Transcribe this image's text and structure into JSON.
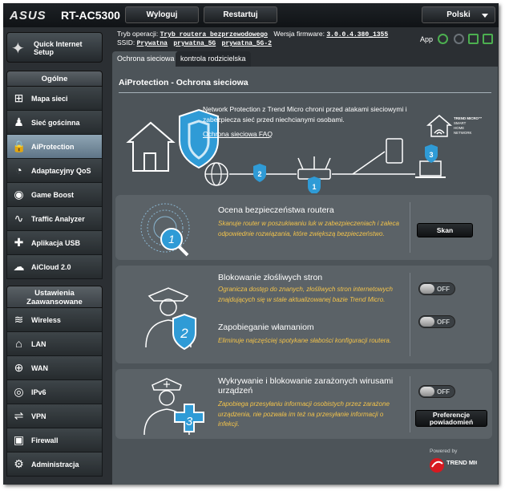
{
  "header": {
    "brand": "ASUS",
    "model": "RT-AC5300",
    "logout": "Wyloguj",
    "restart": "Restartuj",
    "language": "Polski"
  },
  "status": {
    "mode_label": "Tryb operacji:",
    "mode_value": "Tryb routera bezprzewodowego",
    "firmware_label": "Wersja firmware:",
    "firmware_value": "3.0.0.4.380_1355",
    "ssid_label": "SSID:",
    "ssids": [
      "Prywatna",
      "prywatna_5G",
      "prywatna_5G-2"
    ],
    "app_label": "App"
  },
  "sidebar": {
    "qis_label": "Quick Internet Setup",
    "general_header": "Ogólne",
    "general_items": [
      {
        "label": "Mapa sieci",
        "icon": "network-map-icon"
      },
      {
        "label": "Sieć gościnna",
        "icon": "guest-network-icon"
      },
      {
        "label": "AiProtection",
        "icon": "lock-icon"
      },
      {
        "label": "Adaptacyjny QoS",
        "icon": "qos-gauge-icon"
      },
      {
        "label": "Game Boost",
        "icon": "gamepad-icon"
      },
      {
        "label": "Traffic Analyzer",
        "icon": "chart-icon"
      },
      {
        "label": "Aplikacja USB",
        "icon": "puzzle-icon"
      },
      {
        "label": "AiCloud 2.0",
        "icon": "cloud-icon"
      }
    ],
    "advanced_header": "Ustawienia Zaawansowane",
    "advanced_items": [
      {
        "label": "Wireless",
        "icon": "wifi-icon"
      },
      {
        "label": "LAN",
        "icon": "home-icon"
      },
      {
        "label": "WAN",
        "icon": "globe-icon"
      },
      {
        "label": "IPv6",
        "icon": "ipv6-icon"
      },
      {
        "label": "VPN",
        "icon": "vpn-icon"
      },
      {
        "label": "Firewall",
        "icon": "firewall-icon"
      },
      {
        "label": "Administracja",
        "icon": "admin-icon"
      }
    ]
  },
  "tabs": [
    "Ochrona sieciowa",
    "kontrola rodzicielska"
  ],
  "main": {
    "title": "AiProtection - Ochrona sieciowa",
    "intro": "Network Protection z Trend Micro chroni przed atakami sieciowymi i zabezpiecza sieć przed niechcianymi osobami.",
    "faq": "Ochrona sieciowa FAQ",
    "trend_logo_text": "TREND MICRO™ SMART HOME NETWORK",
    "diagram_numbers": [
      "1",
      "2",
      "3"
    ],
    "card1": {
      "number": "1",
      "title": "Ocena bezpieczeństwa routera",
      "desc": "Skanuje router w poszukiwaniu luk w zabezpieczeniach i zaleca odpowiednie rozwiązania, które zwiększą bezpieczeństwo.",
      "button": "Skan"
    },
    "card2": {
      "number": "2",
      "title_a": "Blokowanie złośliwych stron",
      "desc_a": "Ogranicza dostęp do znanych, złośliwych stron internetowych znajdujących się w stale aktualizowanej bazie Trend Micro.",
      "toggle_a": "OFF",
      "title_b": "Zapobieganie włamaniom",
      "desc_b": "Eliminuje najczęściej spotykane słabości konfiguracji routera.",
      "toggle_b": "OFF"
    },
    "card3": {
      "number": "3",
      "title": "Wykrywanie i blokowanie zarażonych wirusami urządzeń",
      "desc": "Zapobiega przesyłaniu informacji osobistych przez zarażone urządzenia, nie pozwala im też na przesyłanie informacji o infekcji.",
      "toggle": "OFF",
      "pref_button": "Preferencje powiadomień"
    },
    "powered_by": "Powered by",
    "trend_micro": "TREND MICRO"
  },
  "colors": {
    "background": "#2b2f33",
    "panel": "#4d5459",
    "card": "#5b6267",
    "desc_text": "#f3c34a",
    "accent_blue": "#2f9bd6",
    "active_nav": "#7f95a5"
  }
}
